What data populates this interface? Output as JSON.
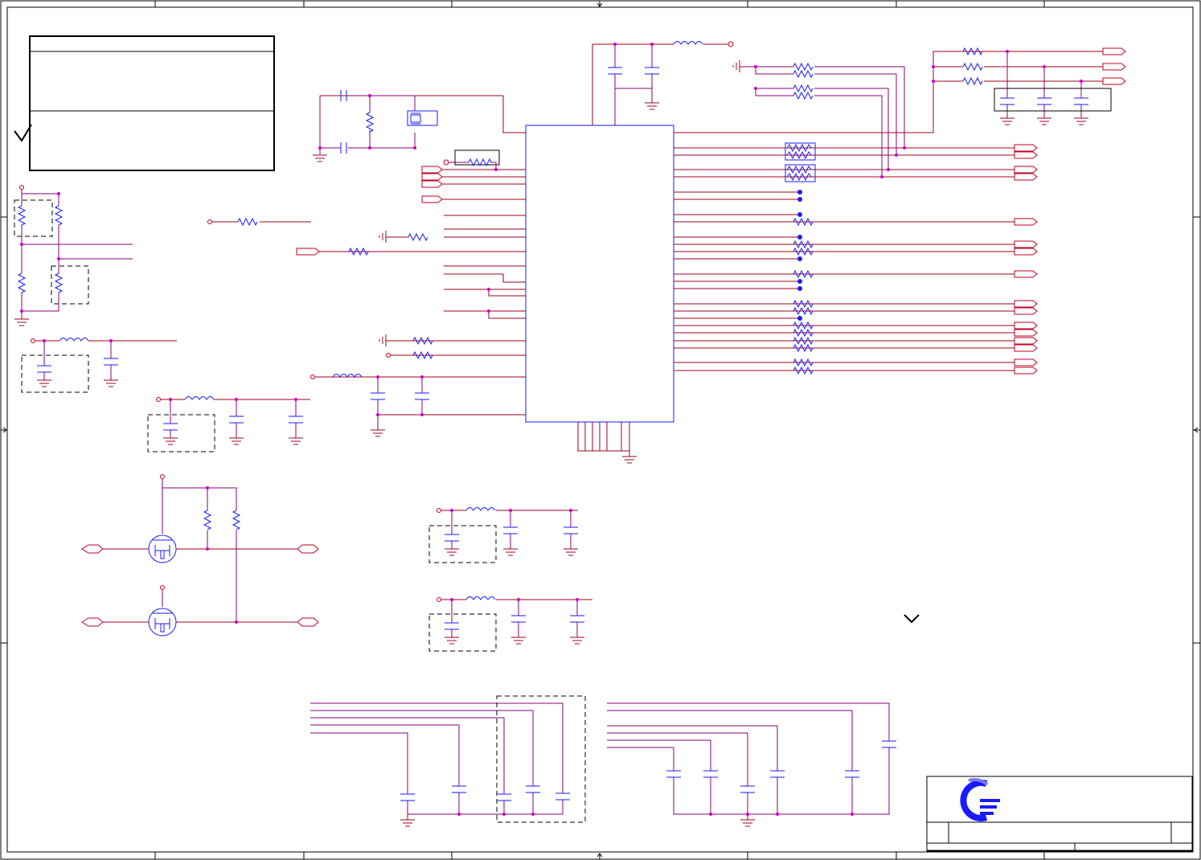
{
  "colors": {
    "wire": "#a0001e",
    "net": "#8a007a",
    "component": "#1a1aff",
    "junction": "#cc00cc",
    "border": "#000000"
  },
  "icons": [
    "checkmark-icon",
    "chevron-down-icon",
    "company-logo-icon",
    "arrow-marker-icon"
  ]
}
